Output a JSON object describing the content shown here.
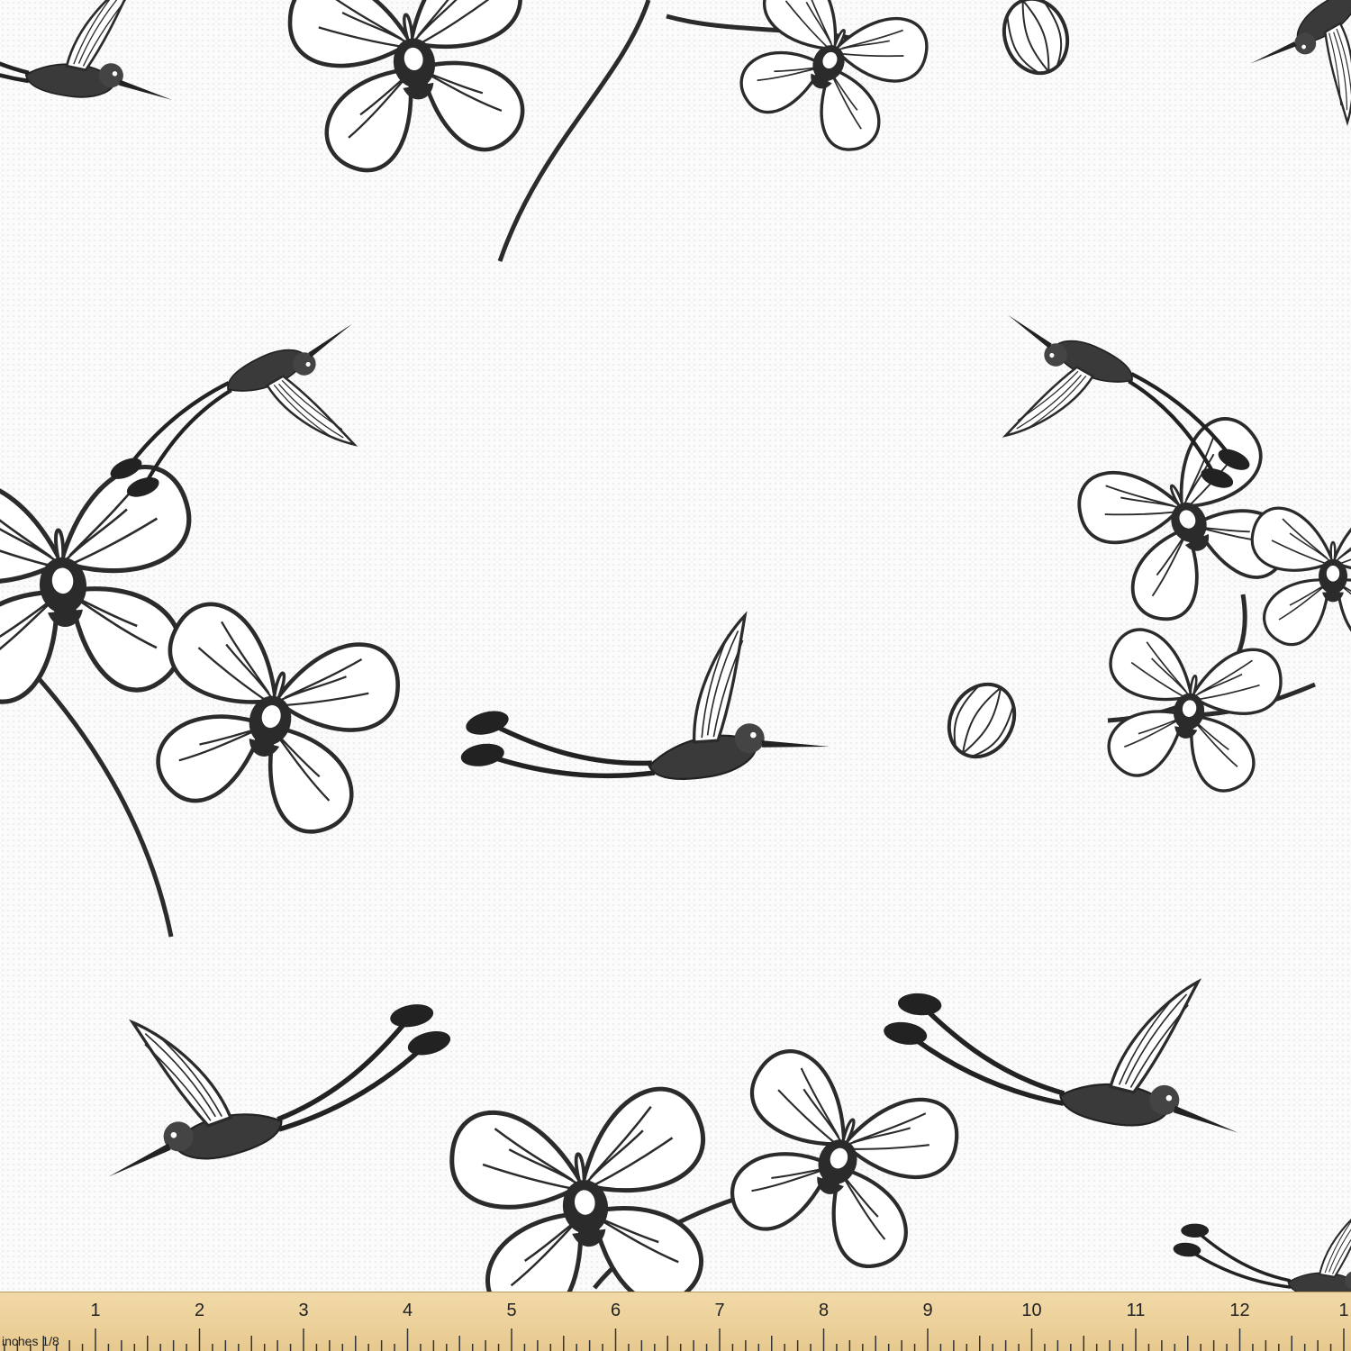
{
  "scene": {
    "background_color": "#fafafa",
    "ink_color": "#2b2b2b",
    "motifs": [
      "orchid-icon",
      "hummingbird-icon",
      "orchid-bud-icon"
    ]
  },
  "ruler": {
    "unit_label": "inches 1/8",
    "numbers": [
      "1",
      "2",
      "3",
      "4",
      "5",
      "6",
      "7",
      "8",
      "9",
      "10",
      "11",
      "12",
      "1"
    ],
    "color": "#ecd09a"
  }
}
